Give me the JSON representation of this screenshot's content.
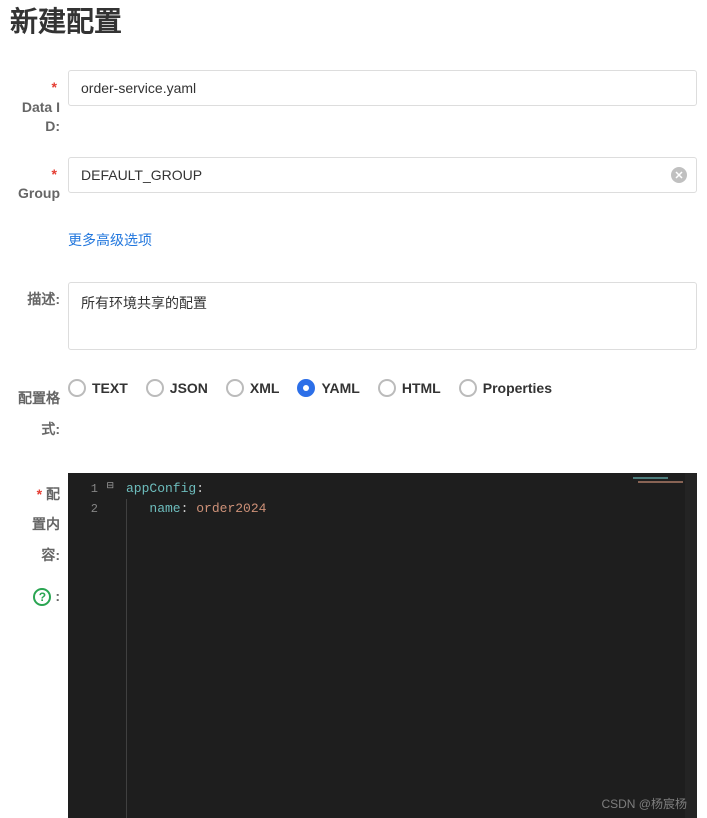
{
  "title": "新建配置",
  "labels": {
    "dataId": "Data ID:",
    "group": "Group",
    "moreOptions": "更多高级选项",
    "description": "描述:",
    "format": "配置格式:",
    "content": "配置内容"
  },
  "fields": {
    "dataId": "order-service.yaml",
    "group": "DEFAULT_GROUP",
    "description": "所有环境共享的配置"
  },
  "formats": {
    "options": [
      {
        "key": "text",
        "label": "TEXT"
      },
      {
        "key": "json",
        "label": "JSON"
      },
      {
        "key": "xml",
        "label": "XML"
      },
      {
        "key": "yaml",
        "label": "YAML"
      },
      {
        "key": "html",
        "label": "HTML"
      },
      {
        "key": "properties",
        "label": "Properties"
      }
    ],
    "selected": "yaml"
  },
  "editor": {
    "lines": [
      {
        "num": "1",
        "indent": 0,
        "key": "appConfig",
        "value": ""
      },
      {
        "num": "2",
        "indent": 1,
        "key": "name",
        "value": "order2024"
      }
    ]
  },
  "watermark": "CSDN @杨宸杨"
}
